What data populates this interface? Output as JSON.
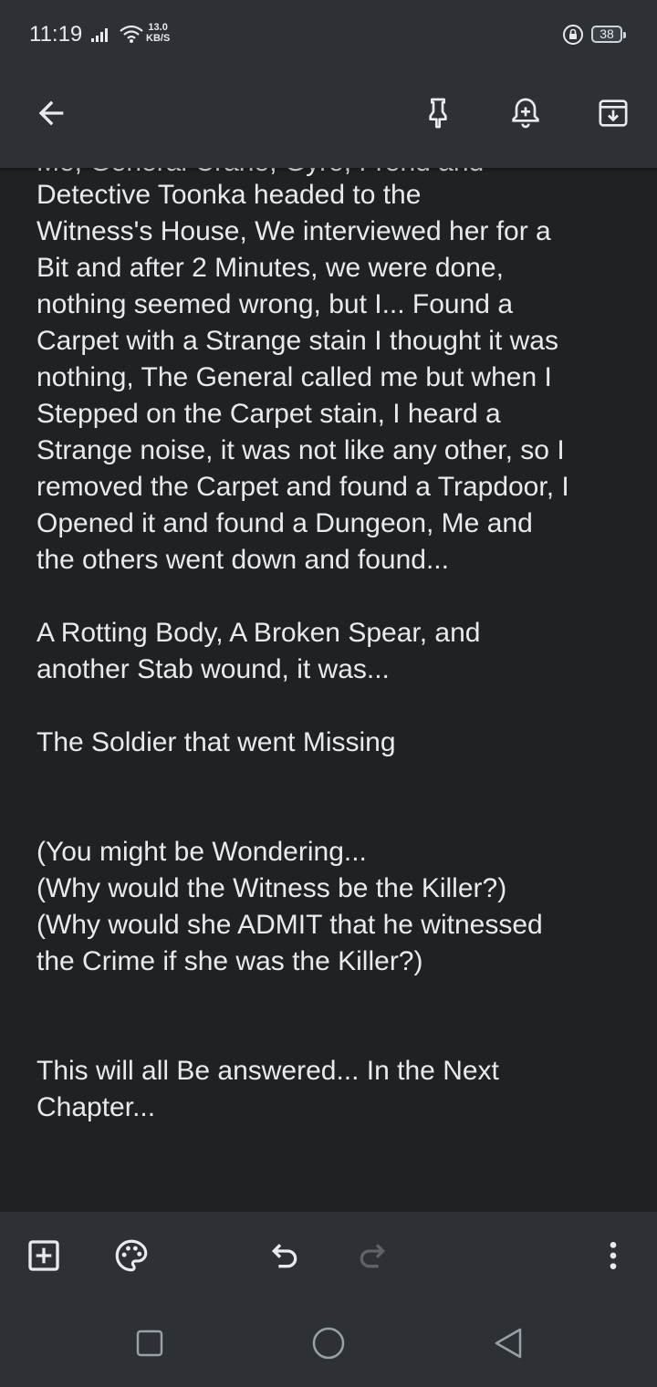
{
  "status_bar": {
    "time": "11:19",
    "net_speed_value": "13.0",
    "net_speed_unit": "KB/S",
    "battery": "38",
    "icons": [
      "signal-icon",
      "wifi-icon",
      "lock-rotation-icon",
      "battery-icon"
    ]
  },
  "toolbar": {
    "icons": [
      "back-arrow-icon",
      "pin-icon",
      "reminder-bell-icon",
      "archive-icon"
    ]
  },
  "note": {
    "cut_off_line": "Me, General Crane, Gyro, Frend and",
    "paragraphs": [
      {
        "lines": [
          "Detective Toonka headed to the",
          "Witness's House, We interviewed her for a",
          "Bit and after 2 Minutes, we were done,",
          "nothing seemed wrong, but I... Found a",
          "Carpet with a Strange stain I thought it was",
          "nothing, The General called me but when I",
          "Stepped on the Carpet stain, I heard a",
          "Strange noise, it was not like any other, so I",
          "removed the Carpet and found a Trapdoor, I",
          "Opened it and found a Dungeon, Me and",
          "the others went down and found..."
        ]
      },
      {
        "lines": [
          "A Rotting Body, A Broken Spear, and",
          "another Stab wound, it was..."
        ]
      },
      {
        "lines": [
          "The Soldier that went Missing"
        ]
      },
      {
        "lines": [
          "(You might be Wondering...",
          "(Why would the Witness be the Killer?)",
          "(Why would she ADMIT that he witnessed",
          "the Crime if she was the Killer?)"
        ]
      },
      {
        "lines": [
          "This will all Be answered... In the Next",
          "Chapter..."
        ]
      }
    ]
  },
  "bottom_bar": {
    "icons": [
      "add-box-icon",
      "palette-icon",
      "undo-icon",
      "redo-icon",
      "more-vert-icon"
    ]
  },
  "nav_bar": {
    "icons": [
      "recents-square-icon",
      "home-circle-icon",
      "back-triangle-icon"
    ]
  },
  "colors": {
    "background": "#202124",
    "bars": "#2d3136",
    "text": "#e8eaed"
  }
}
